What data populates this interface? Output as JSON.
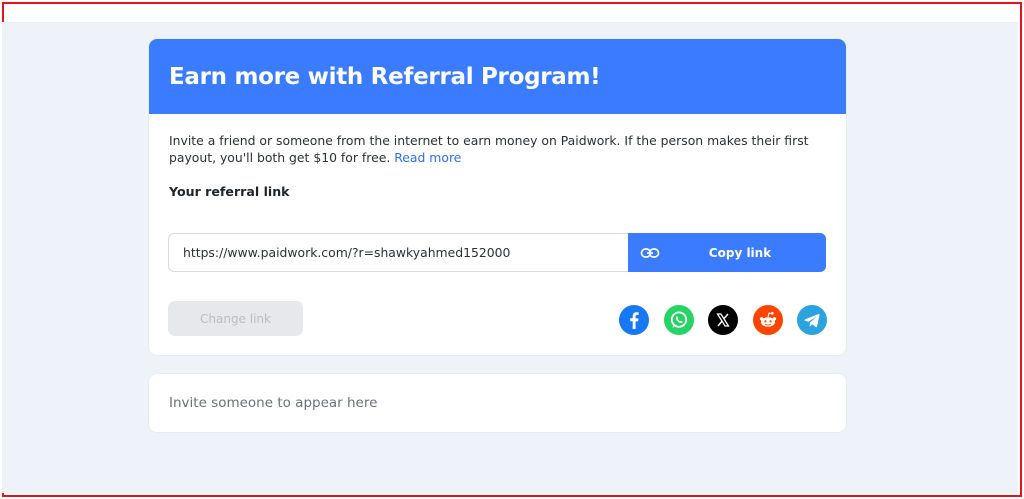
{
  "referral": {
    "title": "Earn more with Referral Program!",
    "description": "Invite a friend or someone from the internet to earn money on Paidwork. If the person makes their first payout, you'll both get $10 for free.",
    "read_more": "Read more",
    "link_label": "Your referral link",
    "link_value": "https://www.paidwork.com/?r=shawkyahmed152000",
    "copy_label": "Copy link",
    "change_label": "Change link"
  },
  "share": [
    {
      "name": "facebook",
      "icon": "facebook-icon",
      "color": "#1877f2"
    },
    {
      "name": "whatsapp",
      "icon": "whatsapp-icon",
      "color": "#25d366"
    },
    {
      "name": "x",
      "icon": "x-icon",
      "color": "#000000"
    },
    {
      "name": "reddit",
      "icon": "reddit-icon",
      "color": "#ff4500"
    },
    {
      "name": "telegram",
      "icon": "telegram-icon",
      "color": "#2aa3df"
    }
  ],
  "invites": {
    "empty_text": "Invite someone to appear here"
  },
  "colors": {
    "accent": "#3b7cff",
    "page_bg": "#eef3f9",
    "frame": "#e5141b"
  }
}
